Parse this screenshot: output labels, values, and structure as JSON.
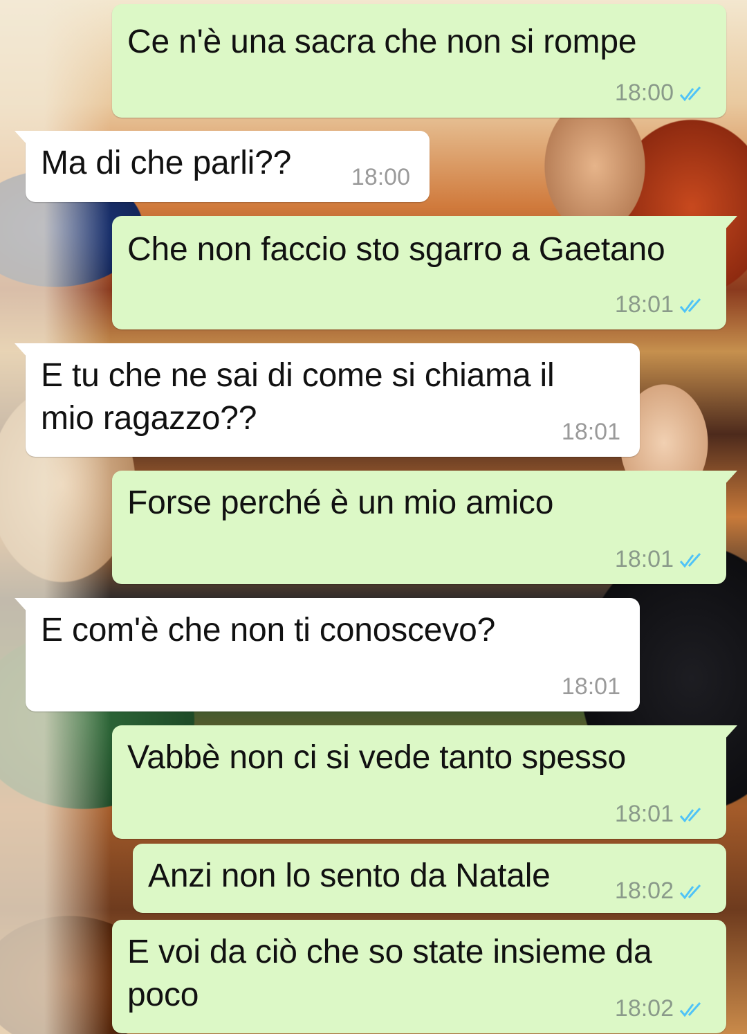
{
  "messages": [
    {
      "direction": "out",
      "text": "Ce n'è una sacra che non si rompe",
      "time": "18:00",
      "status": "read-double-check-icon"
    },
    {
      "direction": "in",
      "text": "Ma di che parli??",
      "time": "18:00"
    },
    {
      "direction": "out",
      "text": "Che non faccio sto sgarro a Gaetano",
      "time": "18:01",
      "status": "read-double-check-icon"
    },
    {
      "direction": "in",
      "text": "E tu che ne sai di come si chiama il\nmio ragazzo??",
      "time": "18:01"
    },
    {
      "direction": "out",
      "text": "Forse perché è un mio amico",
      "time": "18:01",
      "status": "read-double-check-icon"
    },
    {
      "direction": "in",
      "text": "E com'è che non ti conoscevo?",
      "time": "18:01"
    },
    {
      "direction": "out",
      "text": "Vabbè non ci si vede tanto spesso",
      "time": "18:01",
      "status": "read-double-check-icon"
    },
    {
      "direction": "out",
      "text": "Anzi non lo sento da Natale",
      "time": "18:02",
      "status": "read-double-check-icon"
    },
    {
      "direction": "out",
      "text": "E voi da ciò che so state insieme da\npoco",
      "time": "18:02",
      "status": "read-double-check-icon"
    }
  ],
  "colors": {
    "outgoing_bubble": "#dcf8c6",
    "incoming_bubble": "#ffffff",
    "read_ticks": "#4fc3f7",
    "timestamp": "#8a9a8a"
  }
}
